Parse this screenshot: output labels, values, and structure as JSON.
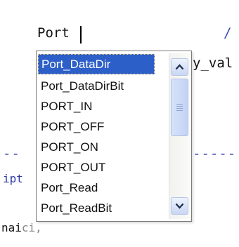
{
  "editor": {
    "line1_text": "Port",
    "line1_comment_char": "/",
    "line2_partial": "y_val",
    "line3_dashes_left": "--",
    "line3_dashes_right": "-----",
    "line4_partial": "ipt",
    "line5_partial": "nai",
    "line5_partial_tail": "ci,"
  },
  "autocomplete": {
    "selected_index": 0,
    "items": [
      {
        "label": "Port_DataDir"
      },
      {
        "label": "Port_DataDirBit"
      },
      {
        "label": "PORT_IN"
      },
      {
        "label": "PORT_OFF"
      },
      {
        "label": "PORT_ON"
      },
      {
        "label": "PORT_OUT"
      },
      {
        "label": "Port_Read"
      },
      {
        "label": "Port_ReadBit"
      }
    ]
  },
  "icons": {
    "scroll_up": "chevron-up-icon",
    "scroll_down": "chevron-down-icon",
    "thumb_grip": "grip-lines-icon"
  },
  "colors": {
    "selection": "#2d5fc9",
    "code_blue": "#2b38a8"
  }
}
